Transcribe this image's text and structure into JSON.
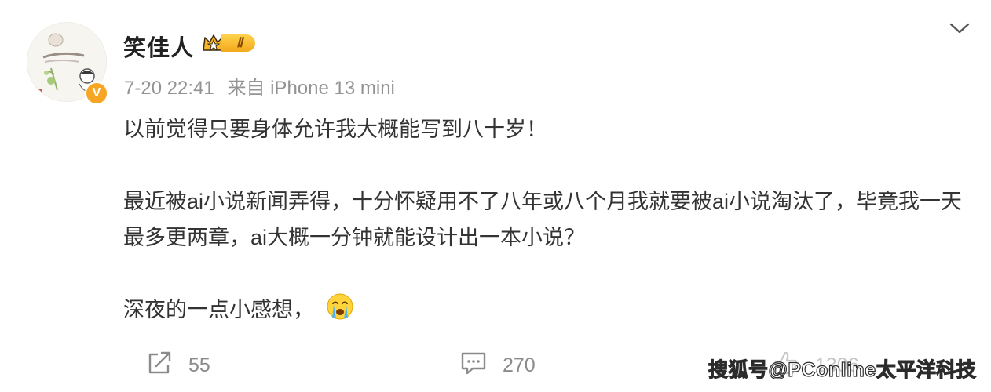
{
  "post": {
    "author": {
      "name": "笑佳人",
      "member_level": "Ⅱ",
      "verified_icon": "verified-v-icon"
    },
    "meta": {
      "time": "7-20 22:41",
      "source": "来自 iPhone 13 mini"
    },
    "content": {
      "paragraph1": "以前觉得只要身体允许我大概能写到八十岁！",
      "paragraph2": "最近被ai小说新闻弄得，十分怀疑用不了八年或八个月我就要被ai小说淘汰了，毕竟我一天最多更两章，ai大概一分钟就能设计出一本小说？",
      "paragraph3": "深夜的一点小感想，",
      "emoji": "crying-face-emoji"
    },
    "actions": {
      "repost_count": "55",
      "comment_count": "270",
      "like_count": "1306"
    }
  },
  "watermark": {
    "text": "搜狐号@PConline太平洋科技"
  },
  "colors": {
    "text_primary": "#333333",
    "text_meta": "#939393",
    "badge_orange": "#f6a623",
    "member_gold": "#f4a91c"
  }
}
